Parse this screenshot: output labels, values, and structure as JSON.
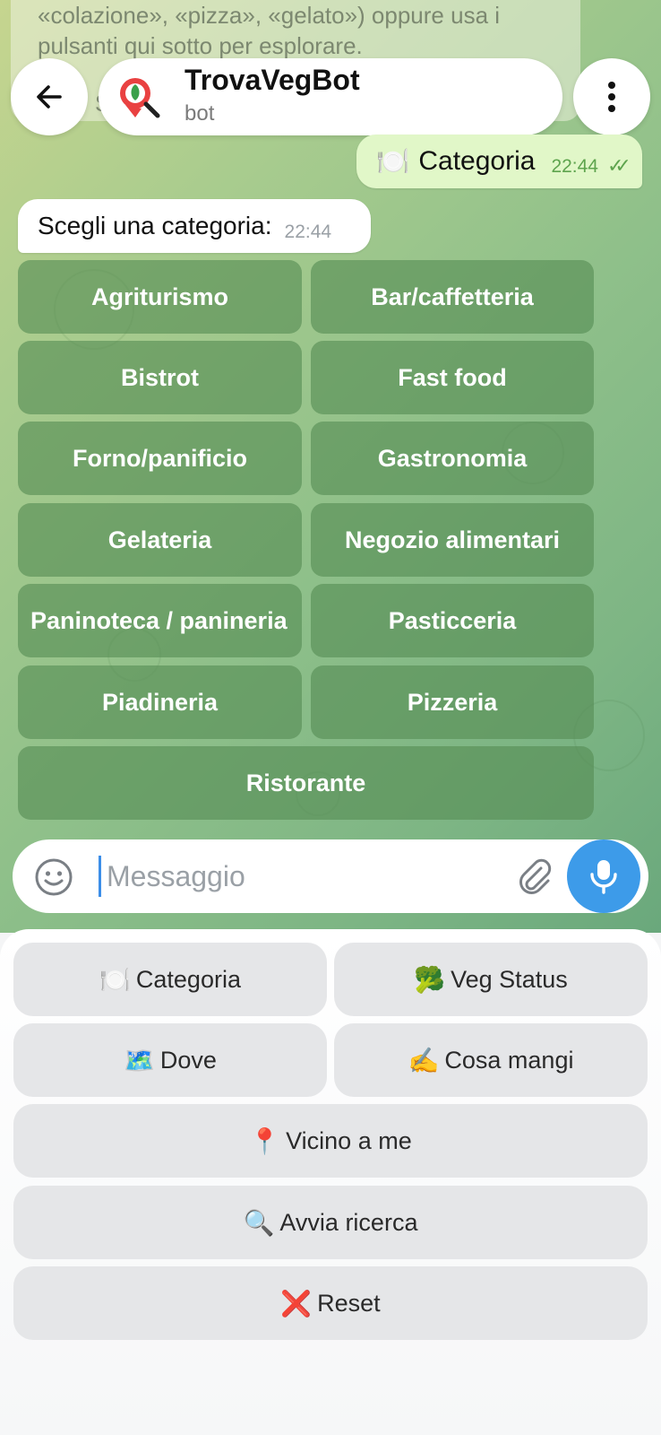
{
  "previous_message": {
    "line1": "«colazione», «pizza», «gelato») oppure usa i",
    "line2": "pulsanti qui sotto per esplorare.",
    "line3_partial": "Se"
  },
  "header": {
    "bot_name": "TrovaVegBot",
    "bot_subtitle": "bot",
    "back_icon": "arrow-left-icon",
    "menu_icon": "more-vertical-icon"
  },
  "messages": [
    {
      "direction": "out",
      "emoji": "🍽️",
      "text": "Categoria",
      "time": "22:44",
      "status": "read"
    },
    {
      "direction": "in",
      "text": "Scegli una categoria:",
      "time": "22:44"
    }
  ],
  "inline_keyboard": {
    "buttons": [
      "Agriturismo",
      "Bar/caffetteria",
      "Bistrot",
      "Fast food",
      "Forno/panificio",
      "Gastronomia",
      "Gelateria",
      "Negozio alimentari",
      "Paninoteca / panineria",
      "Pasticceria",
      "Piadineria",
      "Pizzeria",
      "Ristorante"
    ]
  },
  "composer": {
    "placeholder": "Messaggio",
    "value": ""
  },
  "reply_keyboard": {
    "buttons": [
      {
        "icon": "🍽️",
        "label": "Categoria"
      },
      {
        "icon": "🥦",
        "label": "Veg Status"
      },
      {
        "icon": "🗺️",
        "label": "Dove"
      },
      {
        "icon": "✍️",
        "label": "Cosa mangi"
      },
      {
        "icon": "📍",
        "label": "Vicino a me"
      },
      {
        "icon": "🔍",
        "label": "Avvia ricerca"
      },
      {
        "icon": "❌",
        "label": "Reset"
      }
    ]
  },
  "colors": {
    "accent": "#3d9be9",
    "outgoing_bubble": "#e1f7c8",
    "check_color": "#5ea44e",
    "inline_button": "#568c54"
  }
}
